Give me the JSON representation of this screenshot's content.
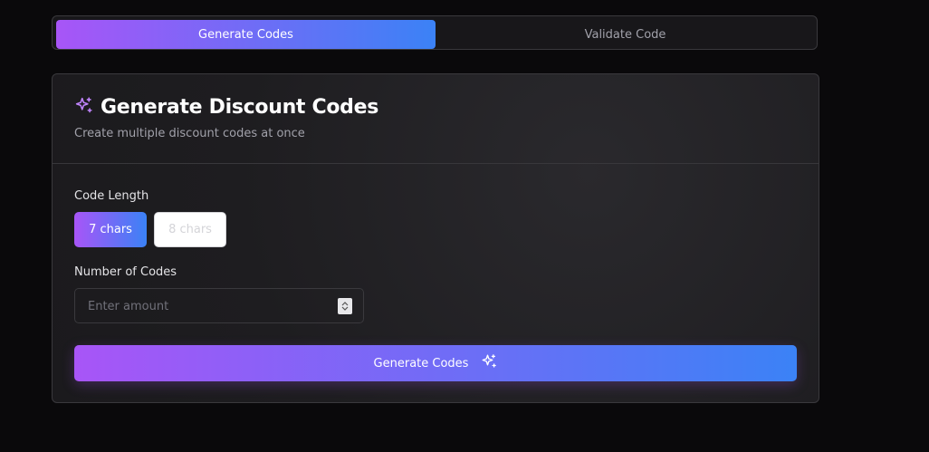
{
  "tabs": [
    {
      "label": "Generate Codes",
      "active": true
    },
    {
      "label": "Validate Code",
      "active": false
    }
  ],
  "card": {
    "title": "Generate Discount Codes",
    "subtitle": "Create multiple discount codes at once",
    "icon": "sparkles-icon"
  },
  "form": {
    "code_length_label": "Code Length",
    "length_options": [
      "7 chars",
      "8 chars"
    ],
    "selected_length": "7 chars",
    "number_label": "Number of Codes",
    "number_placeholder": "Enter amount",
    "submit_label": "Generate Codes"
  },
  "colors": {
    "accent_start": "#a855f7",
    "accent_end": "#3b82f6",
    "background": "#0a090b"
  }
}
